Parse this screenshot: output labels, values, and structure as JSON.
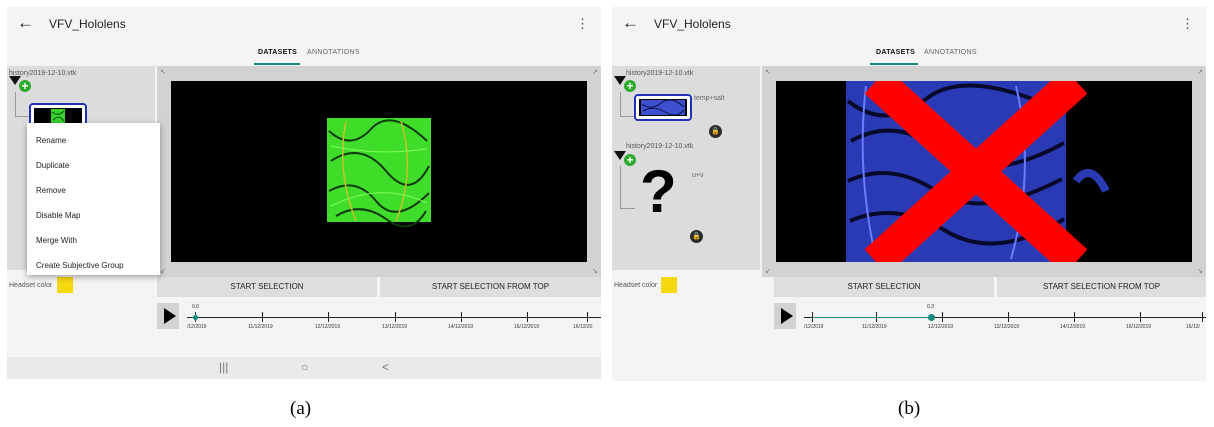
{
  "panels": [
    {
      "title": "VFV_Hololens",
      "tabs": [
        "DATASETS",
        "ANNOTATIONS"
      ],
      "datasets": [
        {
          "name": "history2019-12-10.vtk",
          "map_label": ""
        }
      ],
      "context_menu": [
        "Rename",
        "Duplicate",
        "Remove",
        "Disable Map",
        "Merge With",
        "Create Subjective Group"
      ],
      "headset_label": "Headset color",
      "headset_color": "#f5d90f",
      "buttons": [
        "START SELECTION",
        "START SELECTION FROM TOP"
      ],
      "timeline": {
        "value": "0.0",
        "labels": [
          "/12/2019",
          "11/12/2019",
          "12/12/2019",
          "13/12/2019",
          "14/12/2019",
          "16/12/2019",
          "16/12/20"
        ]
      },
      "navbar": [
        "|||",
        "○",
        "<"
      ],
      "caption": "(a)"
    },
    {
      "title": "VFV_Hololens",
      "tabs": [
        "DATASETS",
        "ANNOTATIONS"
      ],
      "datasets": [
        {
          "name": "history2019-12-10.vtk",
          "map_label": "temp+salt"
        },
        {
          "name": "history2019-12-10.vtk",
          "map_label": "u+v"
        }
      ],
      "headset_label": "Headset color",
      "headset_color": "#f5d90f",
      "buttons": [
        "START SELECTION",
        "START SELECTION FROM TOP"
      ],
      "timeline": {
        "value": "0.3",
        "labels": [
          "/12/2019",
          "11/12/2019",
          "12/12/2019",
          "13/12/2019",
          "14/12/2019",
          "16/12/2019",
          "16/12/"
        ]
      },
      "caption": "(b)"
    }
  ],
  "colors": {
    "accent": "#1a8a7a",
    "add_button": "#2cab2c",
    "selection_border": "#2232b8",
    "x_mark": "#ff0000"
  },
  "icons": {
    "back": "arrow-left-icon",
    "menu": "kebab-icon",
    "play": "play-icon",
    "lock": "lock-icon",
    "add": "plus-icon",
    "placeholder": "question-mark-icon"
  }
}
